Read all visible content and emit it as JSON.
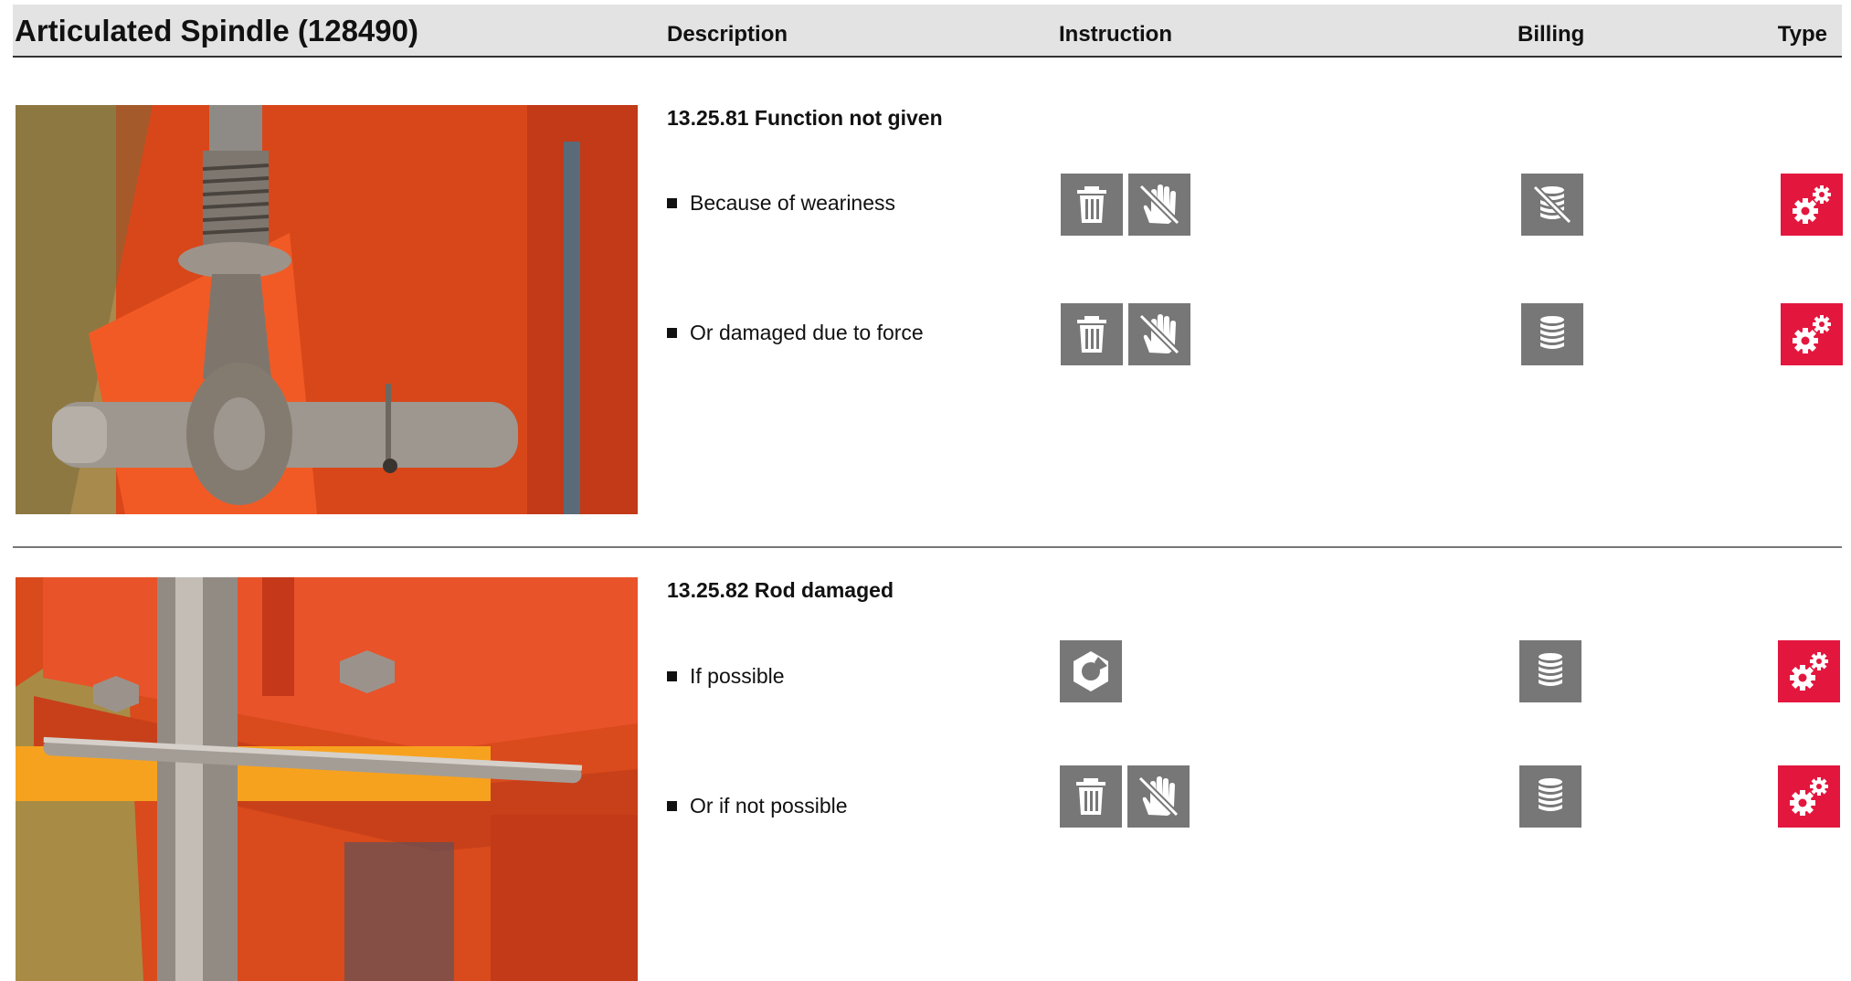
{
  "header": {
    "title": "Articulated Spindle (128490)",
    "columns": {
      "description": "Description",
      "instruction": "Instruction",
      "billing": "Billing",
      "type": "Type"
    }
  },
  "sections": [
    {
      "title": "13.25.81 Function not given",
      "items": [
        {
          "text": "Because of weariness",
          "instruction_icons": [
            "trash-icon",
            "no-touch-icon"
          ],
          "billing_icon": "coin-stack-crossed-icon",
          "type_icon": "gears-icon"
        },
        {
          "text": "Or damaged due to force",
          "instruction_icons": [
            "trash-icon",
            "no-touch-icon"
          ],
          "billing_icon": "coin-stack-icon",
          "type_icon": "gears-icon"
        }
      ]
    },
    {
      "title": "13.25.82 Rod damaged",
      "items": [
        {
          "text": "If possible",
          "instruction_icons": [
            "repair-nut-icon"
          ],
          "billing_icon": "coin-stack-icon",
          "type_icon": "gears-icon"
        },
        {
          "text": "Or if not possible",
          "instruction_icons": [
            "trash-icon",
            "no-touch-icon"
          ],
          "billing_icon": "coin-stack-icon",
          "type_icon": "gears-icon"
        }
      ]
    }
  ],
  "colors": {
    "accent_red": "#e3173e",
    "icon_gray": "#777777",
    "header_bg": "#e3e3e3"
  }
}
